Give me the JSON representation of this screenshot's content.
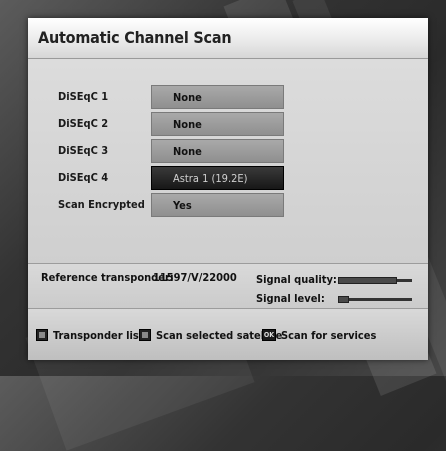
{
  "screen": {
    "title": "Automatic Channel Scan"
  },
  "settings": [
    {
      "label": "DiSEqC 1",
      "value": "None",
      "selected": false
    },
    {
      "label": "DiSEqC 2",
      "value": "None",
      "selected": false
    },
    {
      "label": "DiSEqC 3",
      "value": "None",
      "selected": false
    },
    {
      "label": "DiSEqC 4",
      "value": "Astra 1 (19.2E)",
      "selected": true
    },
    {
      "label": "Scan Encrypted",
      "value": "Yes",
      "selected": false
    }
  ],
  "info": {
    "reference_label": "Reference transponder:",
    "reference_value": "11597/V/22000",
    "signal_quality_label": "Signal quality:",
    "signal_quality_level": 0.8,
    "signal_level_label": "Signal level:",
    "signal_level_level": 0.15
  },
  "footer": {
    "hints": [
      {
        "key": "red-key-icon",
        "label": "Transponder list"
      },
      {
        "key": "green-key-icon",
        "label": "Scan selected satellite"
      },
      {
        "key": "ok-key-icon",
        "key_text": "OK",
        "label": "Scan for services"
      }
    ]
  },
  "colors": {
    "panel": "#d3d3d3",
    "selected_row": "#1f1f1f",
    "row_value": "#9c9c9c"
  }
}
